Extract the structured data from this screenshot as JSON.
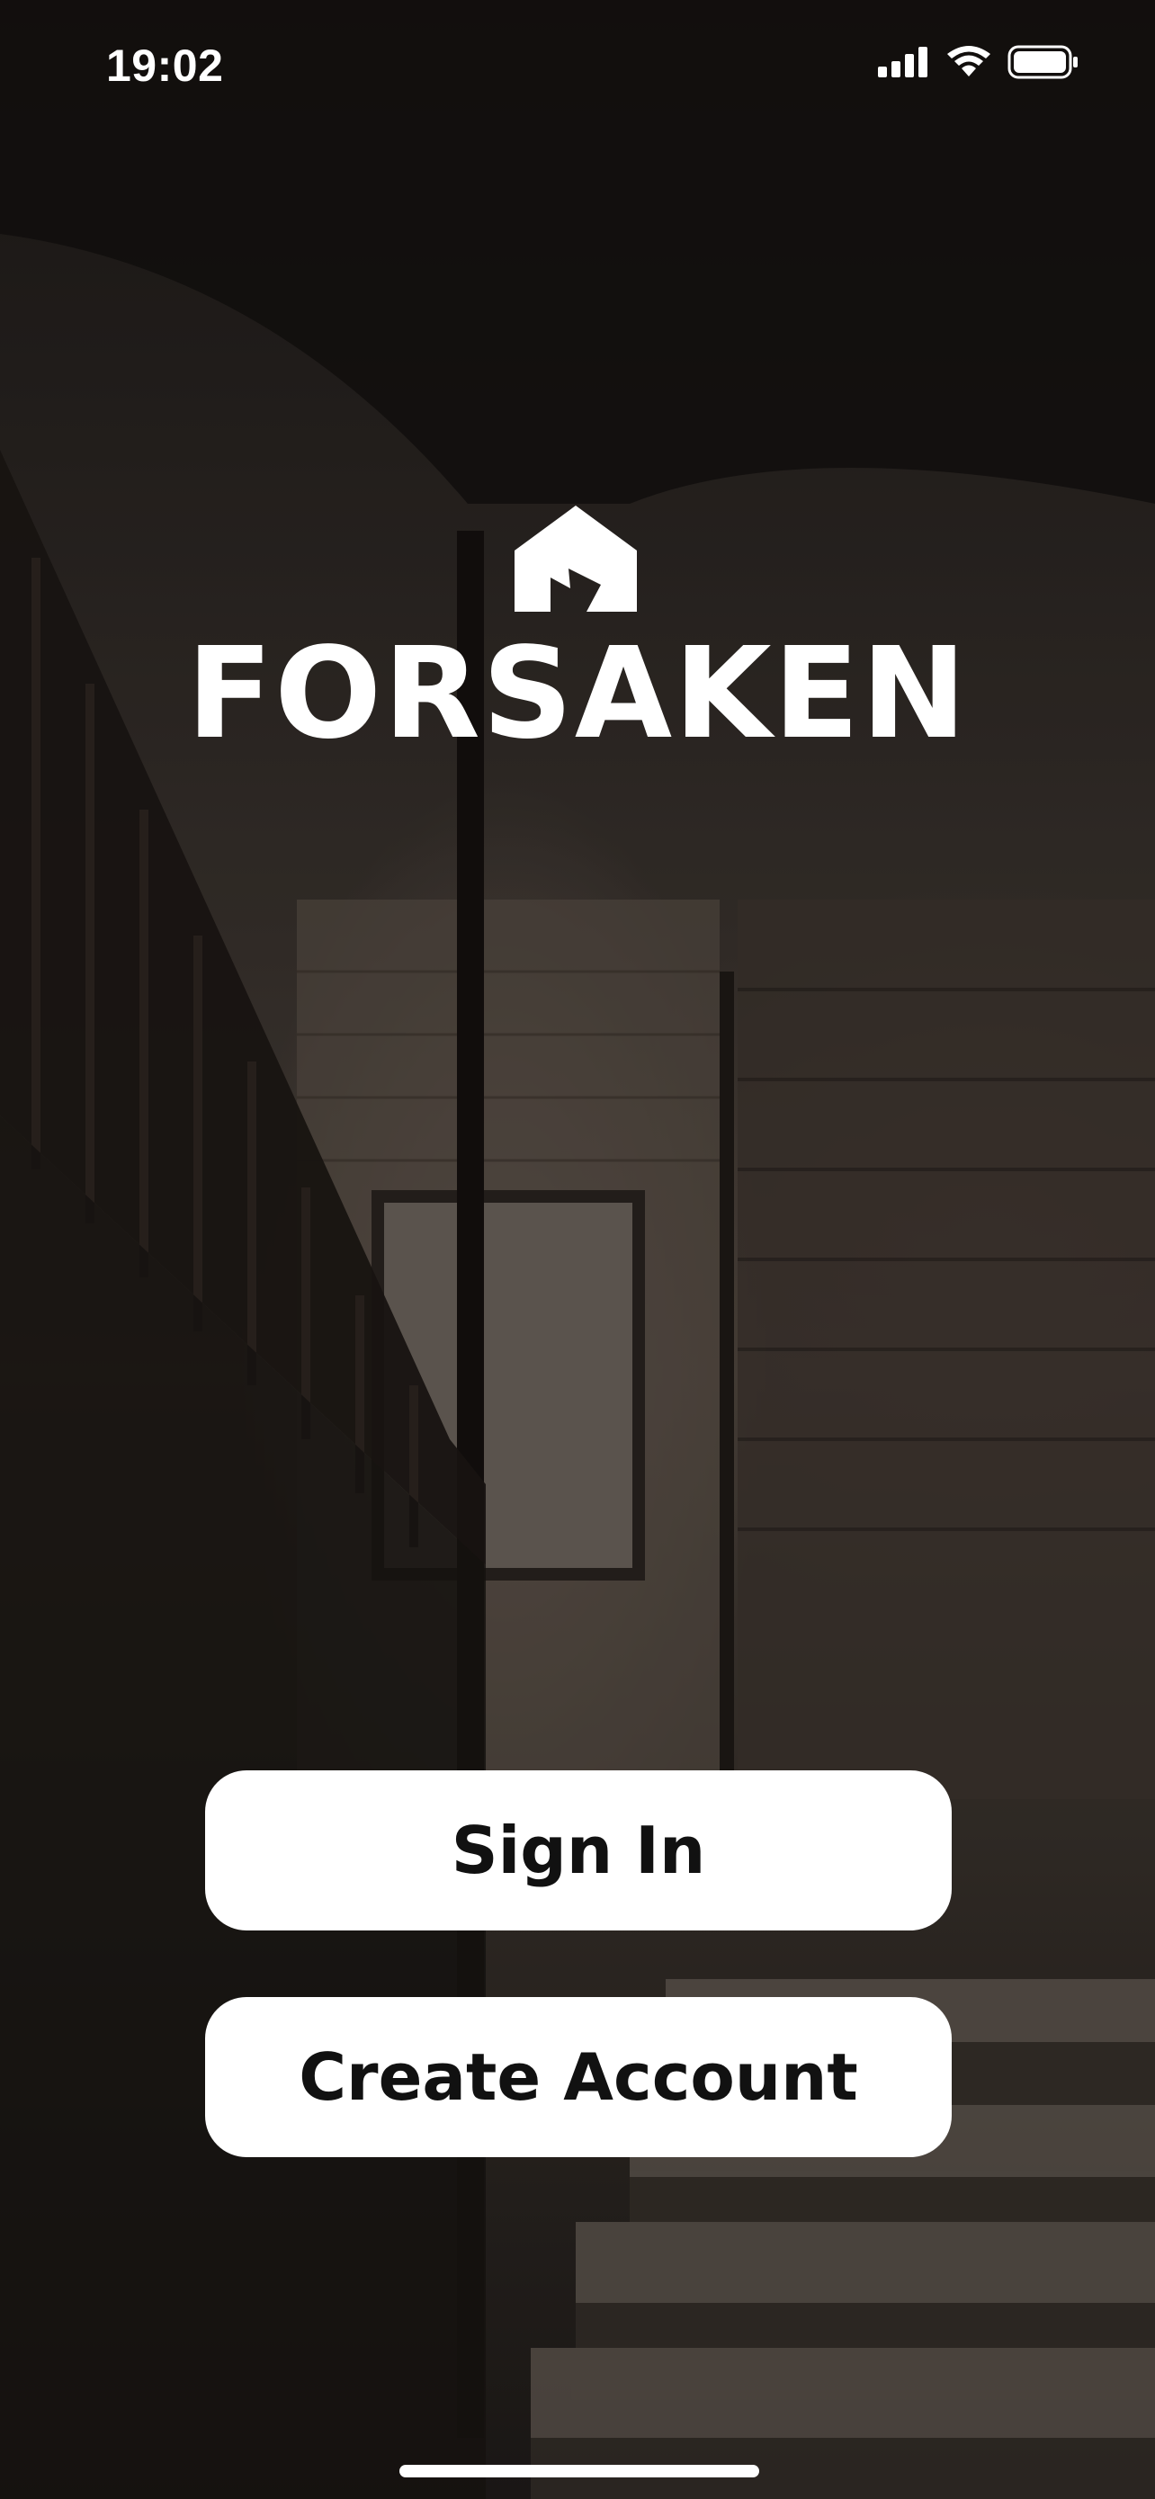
{
  "status_bar": {
    "time": "19:02",
    "icons": [
      "signal-icon",
      "wifi-icon",
      "battery-icon"
    ]
  },
  "brand": {
    "name": "FORSAKEN",
    "logo_icon": "house-logo-icon"
  },
  "actions": {
    "sign_in_label": "Sign In",
    "create_account_label": "Create Account"
  },
  "colors": {
    "button_bg": "#ffffff",
    "button_text": "#111111",
    "brand_text": "#ffffff"
  }
}
